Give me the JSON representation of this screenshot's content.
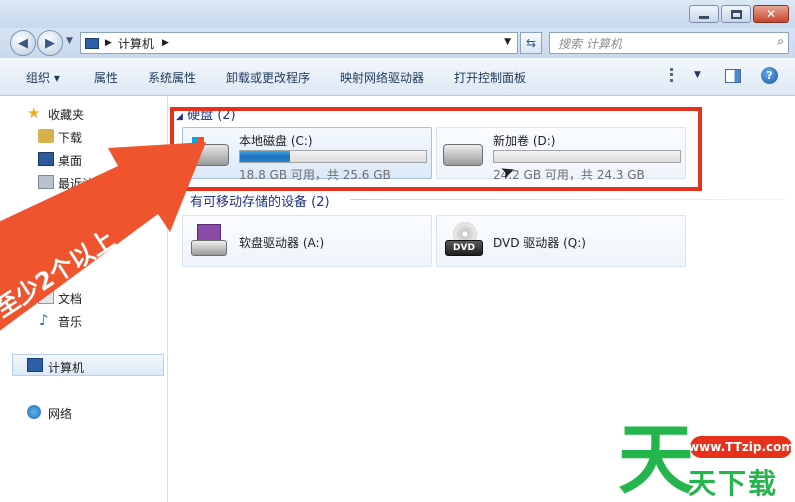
{
  "address": {
    "segments": [
      "计算机"
    ]
  },
  "search": {
    "placeholder": "搜索 计算机"
  },
  "toolbar": {
    "organize": "组织 ▾",
    "properties": "属性",
    "system_properties": "系统属性",
    "uninstall": "卸载或更改程序",
    "map_drive": "映射网络驱动器",
    "control_panel": "打开控制面板"
  },
  "sidebar": {
    "favorites": "收藏夹",
    "downloads": "下载",
    "desktop": "桌面",
    "recent": "最近访问的",
    "documents": "文档",
    "music": "音乐",
    "computer": "计算机",
    "network": "网络"
  },
  "groups": {
    "hdd": "硬盘 (2)",
    "removable": "有可移动存储的设备 (2)"
  },
  "drives": [
    {
      "name": "本地磁盘 (C:)",
      "caption": "18.8 GB 可用，共 25.6 GB",
      "used_fraction": 0.27
    },
    {
      "name": "新加卷 (D:)",
      "caption": "24.2 GB 可用，共 24.3 GB",
      "used_fraction": 0.0
    }
  ],
  "devices": [
    {
      "name": "软盘驱动器 (A:)"
    },
    {
      "name": "DVD 驱动器 (Q:)"
    }
  ],
  "overlay": {
    "arrow_text": "至少2个以上",
    "dvd_label": "DVD"
  },
  "watermark": {
    "url": "www.TTzip.com",
    "char": "天",
    "text": "天下载"
  },
  "colors": {
    "highlight": "#e8311c",
    "arrow": "#f0542f",
    "watermark_green": "#24b64d"
  }
}
